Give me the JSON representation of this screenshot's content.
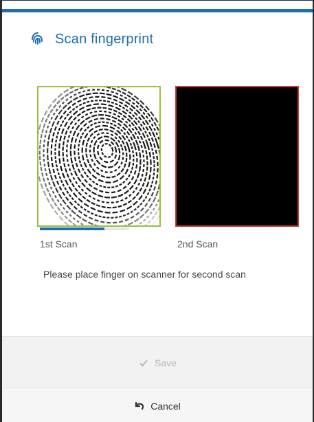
{
  "dialog": {
    "title": "Scan fingerprint",
    "icon": "fingerprint-icon",
    "accent": "#1e6fb0"
  },
  "scans": {
    "first": {
      "label": "1st Scan",
      "border_color": "#9bbf3b",
      "state": "captured"
    },
    "second": {
      "label": "2nd Scan",
      "border_color": "#d23b2e",
      "state": "empty"
    },
    "progress_fraction": 0.72
  },
  "status_message": "Please place finger on scanner for second scan",
  "actions": {
    "save": {
      "label": "Save",
      "icon": "check-icon",
      "disabled": true
    },
    "cancel": {
      "label": "Cancel",
      "icon": "undo-icon"
    }
  }
}
